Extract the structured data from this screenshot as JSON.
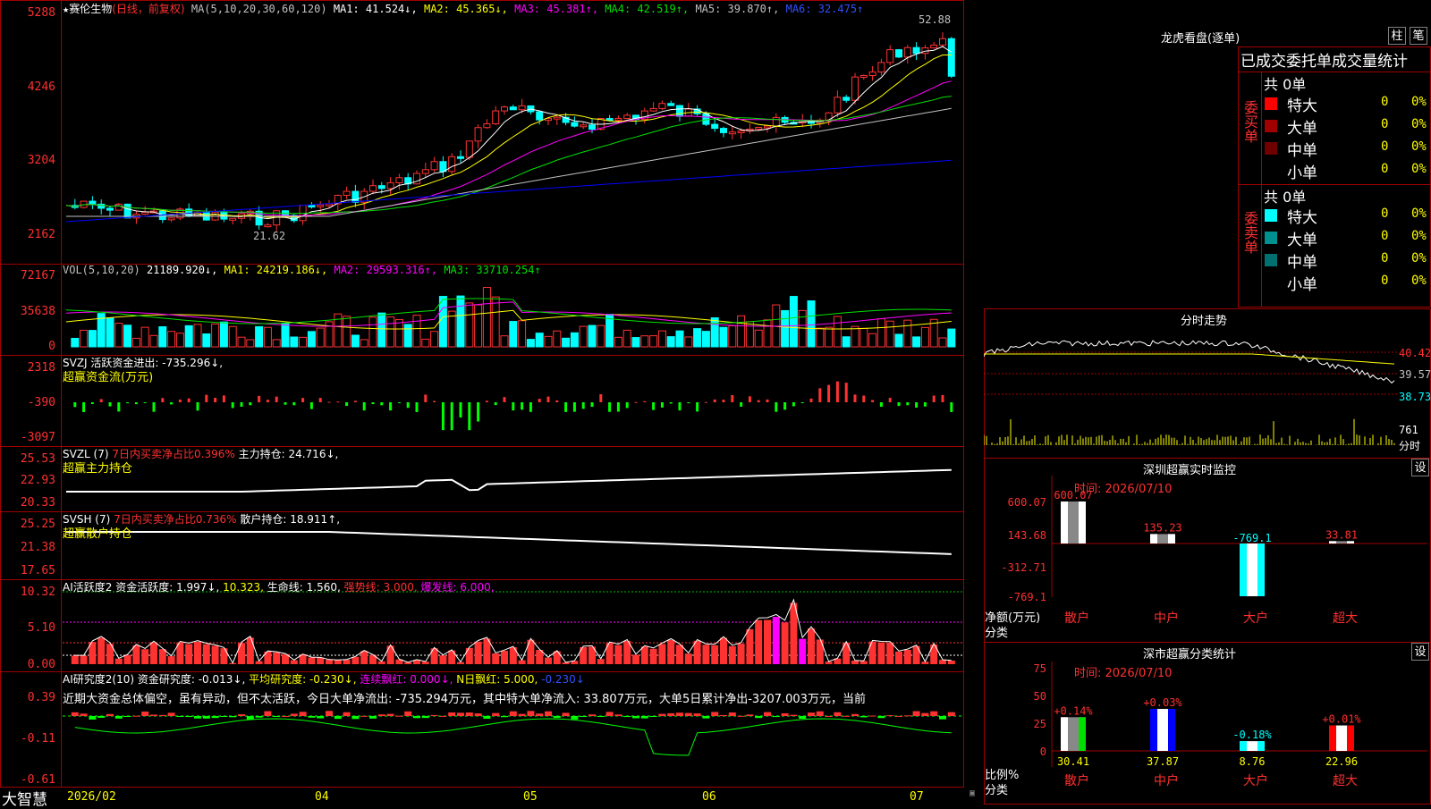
{
  "colors": {
    "up": "#ff3232",
    "down": "#00ffff",
    "frame": "#a00000",
    "ma1": "#ffffff",
    "ma2": "#ffff00",
    "ma3": "#ff00ff",
    "ma4": "#00e000",
    "ma5": "#c0c0c0",
    "ma6": "#0000ff"
  },
  "main": {
    "stock": "赛伦生物",
    "mode": "(日线，前复权)",
    "ma_title": "MA(5,10,20,30,60,120)",
    "ma1": "MA1: 41.524↓,",
    "ma2": "MA2: 45.365↓,",
    "ma3": "MA3: 45.381↑,",
    "ma4": "MA4: 42.519↑,",
    "ma5": "MA5: 39.870↑,",
    "ma6": "MA6: 32.475↑",
    "yticks": [
      "5288",
      "4246",
      "3204",
      "2162"
    ],
    "high_label": "52.88",
    "low_label": "21.62"
  },
  "vol": {
    "title": "VOL(5,10,20)",
    "v": "21189.920↓,",
    "ma1": "MA1: 24219.186↓,",
    "ma2": "MA2: 29593.316↑,",
    "ma3": "MA3: 33710.254↑",
    "yticks": [
      "72167",
      "35638",
      "0"
    ]
  },
  "svzj": {
    "title": "SVZJ  活跃资金进出: -735.296↓,",
    "sub": "超赢资金流(万元)",
    "yticks": [
      "2318",
      "-390",
      "-3097"
    ]
  },
  "svzl": {
    "title": "SVZL (7)",
    "p1": "7日内买卖净占比0.396%",
    "p2": "主力持仓: 24.716↓,",
    "sub": "超赢主力持仓",
    "yticks": [
      "25.53",
      "22.93",
      "20.33"
    ]
  },
  "svsh": {
    "title": "SVSH (7)",
    "p1": "7日内买卖净占比0.736%",
    "p2": "散户持仓: 18.911↑,",
    "sub": "超赢散户持仓",
    "yticks": [
      "25.25",
      "21.38",
      "17.65"
    ]
  },
  "ai1": {
    "title": "AI活跃度2",
    "p1": "资金活跃度: 1.997↓,",
    "p2": "10.323,",
    "p3": "生命线: 1.560,",
    "p4": "强势线: 3.000,",
    "p5": "爆发线: 6.000,",
    "yticks": [
      "10.32",
      "5.10",
      "0.00"
    ]
  },
  "ai2": {
    "title": "AI研究度2(10)",
    "p1": "资金研究度: -0.013↓,",
    "p2": "平均研究度: -0.230↓,",
    "p3": "连续飘红: 0.000↓,",
    "p4": "N日飘红: 5.000,",
    "p5": "-0.230↓",
    "text": "近期大资金总体偏空，虽有异动，但不太活跃，今日大单净流出: -735.294万元，其中特大单净流入: 33.807万元，大单5日累计净出-3207.003万元，当前",
    "yticks": [
      "0.39",
      "-0.11",
      "-0.61"
    ]
  },
  "xaxis": {
    "brand": "大智慧",
    "labels": [
      "2026/02",
      "04",
      "05",
      "06",
      "07"
    ]
  },
  "right": {
    "dragon_title": "龙虎看盘(逐单)",
    "btn1": "柱",
    "btn2": "笔",
    "tabs": "已成交委托单成交量统计",
    "buy": {
      "side": "委买单",
      "total": "共 0单",
      "rows": [
        {
          "name": "特大",
          "v": "0",
          "p": "0%",
          "c": "#ff0000"
        },
        {
          "name": "大单",
          "v": "0",
          "p": "0%",
          "c": "#a00000"
        },
        {
          "name": "中单",
          "v": "0",
          "p": "0%",
          "c": "#700000"
        },
        {
          "name": "小单",
          "v": "0",
          "p": "0%",
          "c": ""
        }
      ]
    },
    "sell": {
      "side": "委卖单",
      "total": "共 0单",
      "rows": [
        {
          "name": "特大",
          "v": "0",
          "p": "0%",
          "c": "#00ffff"
        },
        {
          "name": "大单",
          "v": "0",
          "p": "0%",
          "c": "#009090"
        },
        {
          "name": "中单",
          "v": "0",
          "p": "0%",
          "c": "#007070"
        },
        {
          "name": "小单",
          "v": "0",
          "p": "0%",
          "c": ""
        }
      ]
    },
    "intraday": {
      "title": "分时走势",
      "yticks": [
        "40.42",
        "39.57",
        "38.73"
      ],
      "vol": "761",
      "vol_unit": "分时"
    },
    "monitor": {
      "title": "深圳超赢实时监控",
      "btn": "设",
      "time": "时间: 2026/07/10",
      "ylab": "净额(万元)",
      "xlab": "分类",
      "yticks": [
        "600.07",
        "143.68",
        "-312.71",
        "-769.1"
      ],
      "cats": [
        "散户",
        "中户",
        "大户",
        "超大"
      ],
      "values": [
        "600.07",
        "135.23",
        "-769.1",
        "33.81"
      ]
    },
    "stats": {
      "title": "深市超赢分类统计",
      "btn": "设",
      "time": "时间: 2026/07/10",
      "ylab": "比例%",
      "xlab": "分类",
      "yticks": [
        "75",
        "50",
        "25",
        "0"
      ],
      "cats": [
        "散户",
        "中户",
        "大户",
        "超大"
      ],
      "changes": [
        "+0.14%",
        "+0.03%",
        "-0.18%",
        "+0.01%"
      ],
      "values": [
        "30.41",
        "37.87",
        "8.76",
        "22.96"
      ]
    }
  }
}
